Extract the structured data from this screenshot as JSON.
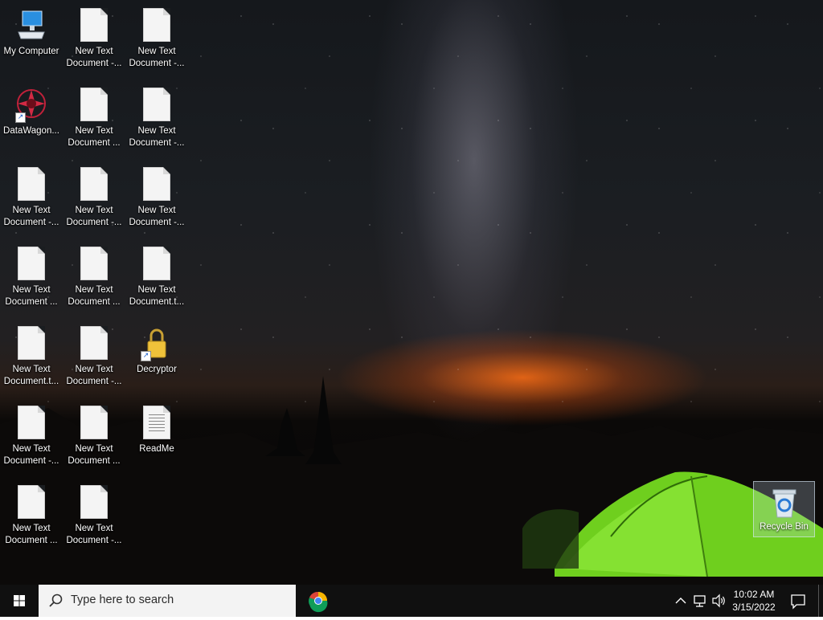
{
  "desktop": {
    "icons": [
      {
        "label": "My Computer",
        "type": "computer"
      },
      {
        "label": "New Text\nDocument -...",
        "type": "doc"
      },
      {
        "label": "New Text\nDocument -...",
        "type": "doc"
      },
      {
        "label": "DataWagon...",
        "type": "app"
      },
      {
        "label": "New Text\nDocument ...",
        "type": "doc"
      },
      {
        "label": "New Text\nDocument -...",
        "type": "doc"
      },
      {
        "label": "New Text\nDocument -...",
        "type": "doc"
      },
      {
        "label": "New Text\nDocument -...",
        "type": "doc"
      },
      {
        "label": "New Text\nDocument -...",
        "type": "doc"
      },
      {
        "label": "New Text\nDocument ...",
        "type": "doc"
      },
      {
        "label": "New Text\nDocument ...",
        "type": "doc"
      },
      {
        "label": "New Text\nDocument.t...",
        "type": "doc"
      },
      {
        "label": "New Text\nDocument.t...",
        "type": "doc"
      },
      {
        "label": "New Text\nDocument -...",
        "type": "doc"
      },
      {
        "label": "Decryptor",
        "type": "lock"
      },
      {
        "label": "New Text\nDocument -...",
        "type": "doc"
      },
      {
        "label": "New Text\nDocument ...",
        "type": "doc"
      },
      {
        "label": "ReadMe",
        "type": "notepad"
      },
      {
        "label": "New Text\nDocument ...",
        "type": "doc"
      },
      {
        "label": "New Text\nDocument -...",
        "type": "doc"
      }
    ],
    "recycle_bin": {
      "label": "Recycle Bin"
    }
  },
  "taskbar": {
    "search_placeholder": "Type here to search",
    "pinned": [
      {
        "icon": "chrome-icon"
      }
    ],
    "tray": {
      "time": "10:02 AM",
      "date": "3/15/2022",
      "icons": [
        "chevron-up-icon",
        "network-icon",
        "volume-icon"
      ]
    },
    "start_icon": "windows-logo-icon",
    "notification_icon": "action-center-icon"
  }
}
